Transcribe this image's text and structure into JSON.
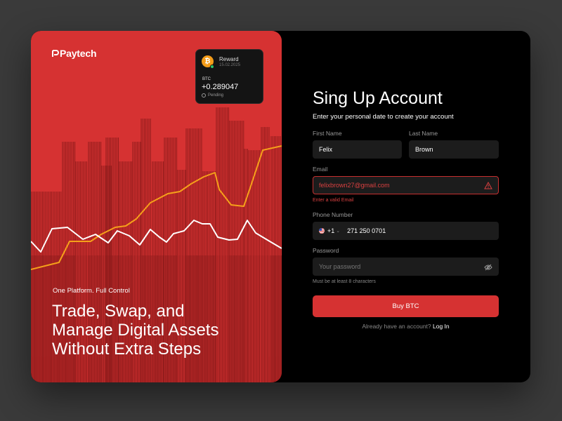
{
  "brand": {
    "name": "Paytech"
  },
  "reward_card": {
    "title": "Reward",
    "date": "15.02.2025",
    "asset": "BTC",
    "amount": "+0.289047",
    "status": "Pending",
    "coin_symbol": "₿",
    "coin_color": "#f39c19"
  },
  "hero": {
    "tagline": "One Platform. Full Control",
    "headline_line1": "Trade, Swap, and",
    "headline_line2": "Manage Digital Assets",
    "headline_line3": "Without Extra Steps"
  },
  "form": {
    "title": "Sing Up Account",
    "subtitle": "Enter your personal date to create your account",
    "first_name": {
      "label": "First Name",
      "value": "Felix"
    },
    "last_name": {
      "label": "Last Name",
      "value": "Brown"
    },
    "email": {
      "label": "Email",
      "value": "felixbrown27@gmail.com",
      "error": "Enter a valid Email"
    },
    "phone": {
      "label": "Phone Number",
      "country_code": "+1",
      "value": "271 250 0701"
    },
    "password": {
      "label": "Password",
      "placeholder": "Your password",
      "hint": "Must be at least 8 characters"
    },
    "submit_label": "Buy BTC",
    "signin_prompt": "Already have an account?",
    "signin_link": "Log In"
  },
  "colors": {
    "accent": "#d63232",
    "orange_line": "#f5a01a",
    "white_line": "#ffffff"
  }
}
